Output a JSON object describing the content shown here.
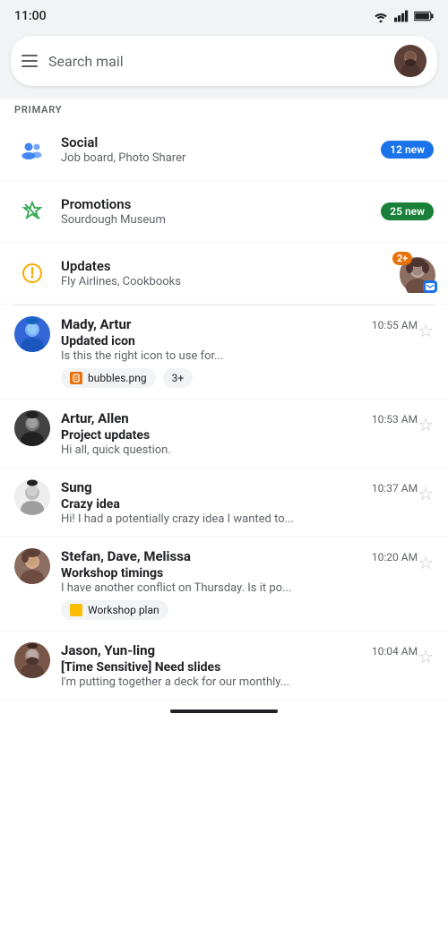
{
  "statusBar": {
    "time": "11:00"
  },
  "searchBar": {
    "placeholder": "Search mail"
  },
  "sectionLabel": "PRIMARY",
  "categories": [
    {
      "id": "social",
      "name": "Social",
      "subtitle": "Job board, Photo Sharer",
      "badge": "12 new",
      "badgeColor": "blue"
    },
    {
      "id": "promotions",
      "name": "Promotions",
      "subtitle": "Sourdough Museum",
      "badge": "25 new",
      "badgeColor": "green"
    },
    {
      "id": "updates",
      "name": "Updates",
      "subtitle": "Fly Airlines, Cookbooks",
      "count": "2+"
    }
  ],
  "emails": [
    {
      "id": "mady-artur",
      "sender": "Mady, Artur",
      "time": "10:55 AM",
      "subject": "Updated icon",
      "preview": "Is this the right icon to use for...",
      "avatarColor": "mady",
      "attachments": [
        "bubbles.png"
      ],
      "moreAttachments": "3+",
      "starred": false
    },
    {
      "id": "artur-allen",
      "sender": "Artur, Allen",
      "time": "10:53 AM",
      "subject": "Project updates",
      "preview": "Hi all, quick question.",
      "avatarColor": "artur",
      "starred": false
    },
    {
      "id": "sung",
      "sender": "Sung",
      "time": "10:37 AM",
      "subject": "Crazy idea",
      "preview": "Hi! I had a potentially crazy idea I wanted to...",
      "avatarColor": "sung",
      "starred": false
    },
    {
      "id": "stefan-dave-melissa",
      "sender": "Stefan, Dave, Melissa",
      "time": "10:20 AM",
      "subject": "Workshop timings",
      "preview": "I have another conflict on Thursday. Is it po...",
      "avatarColor": "stefan",
      "attachments": [
        "Workshop plan"
      ],
      "attachmentType": "doc",
      "starred": false
    },
    {
      "id": "jason-yunling",
      "sender": "Jason, Yun-ling",
      "time": "10:04 AM",
      "subject": "[Time Sensitive] Need slides",
      "preview": "I'm putting together a deck for our monthly...",
      "avatarColor": "jason",
      "starred": false
    }
  ],
  "labels": {
    "attachment_more": "3+",
    "workshop_attachment": "Workshop plan"
  }
}
